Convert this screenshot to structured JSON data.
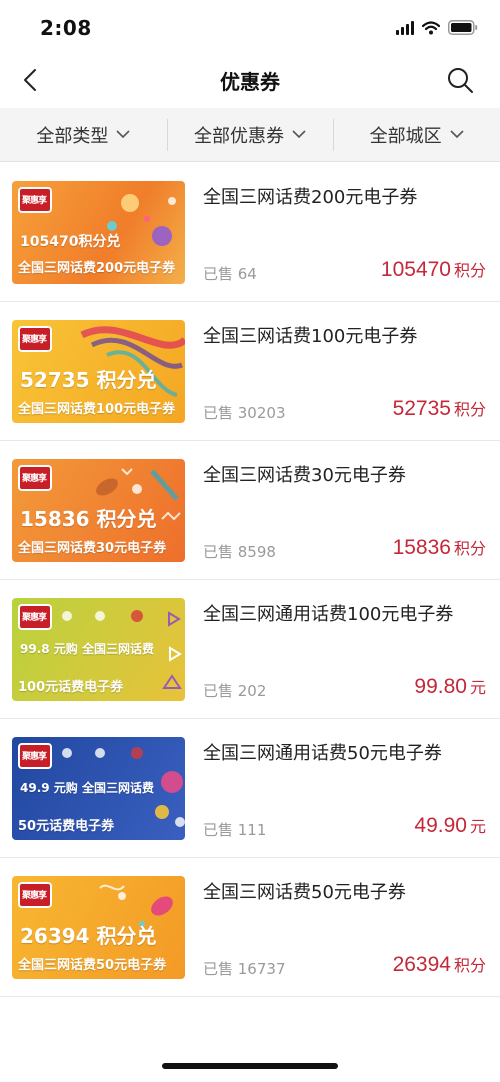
{
  "status_bar": {
    "time": "2:08"
  },
  "nav": {
    "title": "优惠券"
  },
  "filters": [
    {
      "label": "全部类型"
    },
    {
      "label": "全部优惠券"
    },
    {
      "label": "全部城区"
    }
  ],
  "coupons": [
    {
      "title": "全国三网话费200元电子券",
      "sold": "已售 64",
      "price": "105470",
      "unit": "积分",
      "image": {
        "line1": "105470积分兑",
        "line2": "全国三网话费200元电子券",
        "bg": "#f38b2c"
      }
    },
    {
      "title": "全国三网话费100元电子券",
      "sold": "已售 30203",
      "price": "52735",
      "unit": "积分",
      "image": {
        "line1": "52735 积分兑",
        "line2": "全国三网话费100元电子券",
        "bg": "#f7b52b"
      }
    },
    {
      "title": "全国三网话费30元电子券",
      "sold": "已售 8598",
      "price": "15836",
      "unit": "积分",
      "image": {
        "line1": "15836 积分兑",
        "line2": "全国三网话费30元电子券",
        "bg": "#f0792a"
      }
    },
    {
      "title": "全国三网通用话费100元电子券",
      "sold": "已售 202",
      "price": "99.80",
      "unit": "元",
      "image": {
        "line1": "99.8 元购 全国三网话费",
        "line2": "100元话费电子券",
        "bg": "#a6c93a"
      }
    },
    {
      "title": "全国三网通用话费50元电子券",
      "sold": "已售 111",
      "price": "49.90",
      "unit": "元",
      "image": {
        "line1": "49.9 元购 全国三网话费",
        "line2": "50元话费电子券",
        "bg": "#2b4fa8"
      }
    },
    {
      "title": "全国三网话费50元电子券",
      "sold": "已售 16737",
      "price": "26394",
      "unit": "积分",
      "image": {
        "line1": "26394 积分兑",
        "line2": "全国三网话费50元电子券",
        "bg": "#f6a92c"
      }
    }
  ],
  "colors": {
    "price": "#c4283a",
    "filter_bg": "#f4f4f4"
  },
  "logo_text": "聚惠享"
}
